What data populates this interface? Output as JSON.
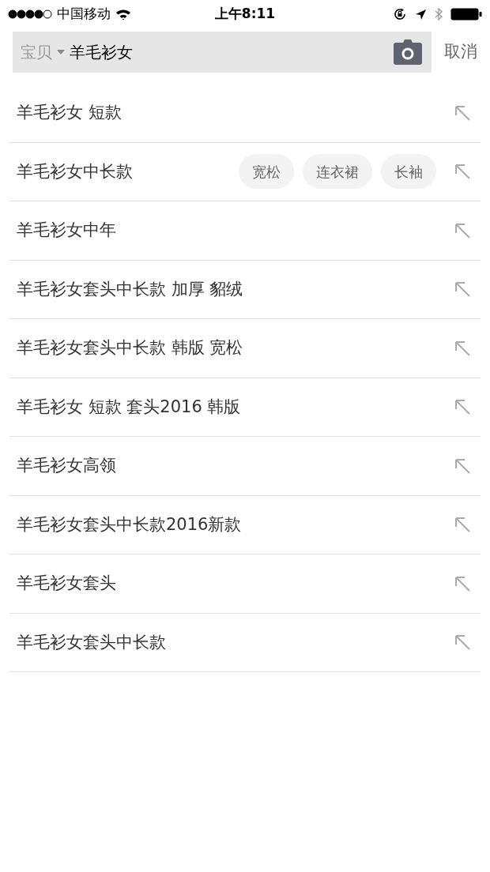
{
  "status_bar": {
    "carrier": "中国移动",
    "time": "上午8:11"
  },
  "search": {
    "category": "宝贝",
    "value": "羊毛衫女",
    "cancel": "取消"
  },
  "suggestions": [
    {
      "text": "羊毛衫女 短款"
    },
    {
      "text": "羊毛衫女中长款",
      "tags": [
        "宽松",
        "连衣裙",
        "长袖"
      ]
    },
    {
      "text": "羊毛衫女中年"
    },
    {
      "text": "羊毛衫女套头中长款 加厚 貂绒"
    },
    {
      "text": "羊毛衫女套头中长款 韩版 宽松"
    },
    {
      "text": "羊毛衫女 短款 套头2016 韩版"
    },
    {
      "text": "羊毛衫女高领"
    },
    {
      "text": "羊毛衫女套头中长款2016新款"
    },
    {
      "text": "羊毛衫女套头"
    },
    {
      "text": "羊毛衫女套头中长款"
    }
  ]
}
